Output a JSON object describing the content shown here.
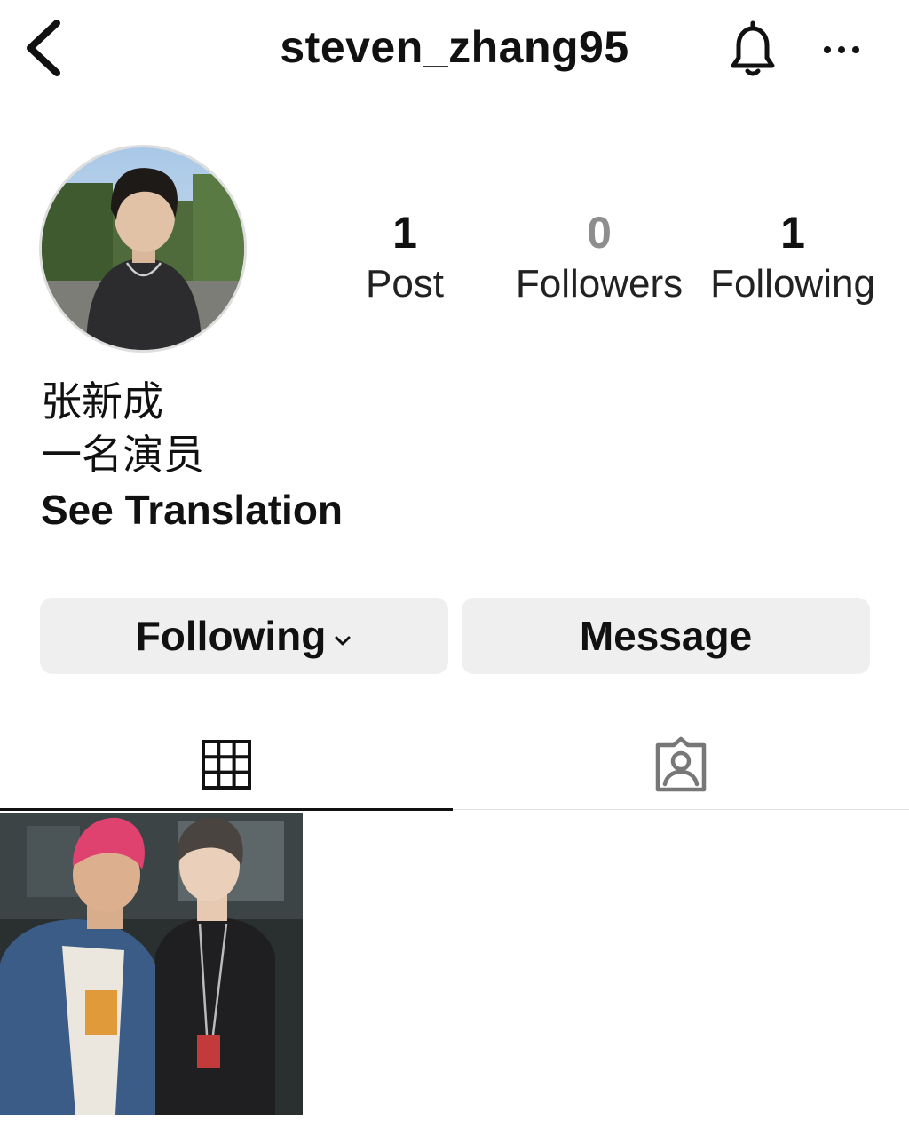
{
  "header": {
    "username": "steven_zhang95",
    "back_icon": "chevron-left-icon",
    "bell_icon": "bell-icon",
    "more_icon": "more-horizontal-icon"
  },
  "stats": {
    "posts": {
      "count": "1",
      "label": "Post"
    },
    "followers": {
      "count": "0",
      "label": "Followers"
    },
    "following": {
      "count": "1",
      "label": "Following"
    }
  },
  "bio": {
    "name": "张新成",
    "text": "一名演员",
    "see_translation": "See Translation"
  },
  "actions": {
    "following_label": "Following",
    "message_label": "Message"
  },
  "tabs": {
    "grid_icon": "grid-icon",
    "tagged_icon": "tagged-person-icon",
    "active": "grid"
  },
  "colors": {
    "button_bg": "#efefef",
    "text": "#111111",
    "muted_count": "#8e8e8e"
  }
}
